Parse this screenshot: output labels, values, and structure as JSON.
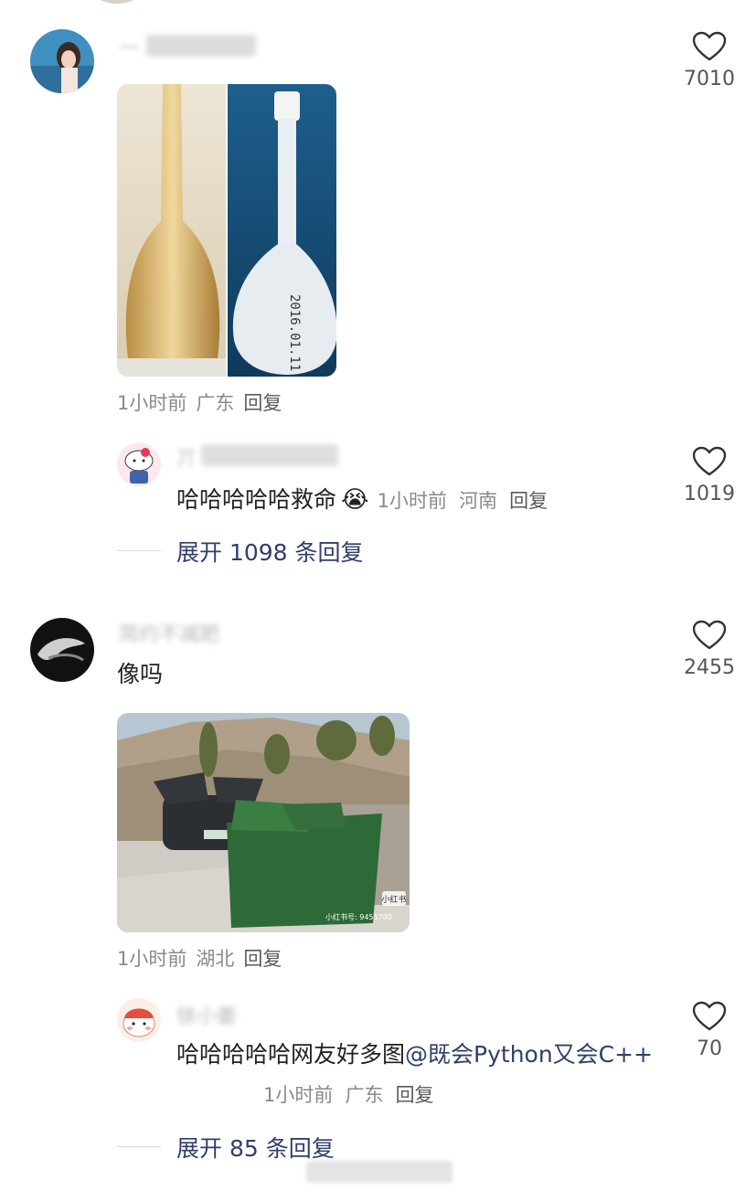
{
  "comments": [
    {
      "name": "一",
      "time": "1小时前",
      "location": "广东",
      "reply": "回复",
      "likes": "7010",
      "reply_preview": {
        "name": "丌",
        "text": "哈哈哈哈哈救命",
        "emoji": "😭",
        "time": "1小时前",
        "location": "河南",
        "reply": "回复",
        "likes": "1019"
      },
      "expand": "展开 1098 条回复"
    },
    {
      "name": "简约不减肥",
      "text": "像吗",
      "time": "1小时前",
      "location": "湖北",
      "reply": "回复",
      "likes": "2455",
      "image_watermark": "小红书",
      "image_watermark_id": "小红书号: 9455780",
      "reply_preview": {
        "name": "徐小姜",
        "text_part1": "哈哈哈哈哈网友好多图",
        "mention": "@既会Python又会C++",
        "time": "1小时前",
        "location": "广东",
        "reply": "回复",
        "likes": "70"
      },
      "expand": "展开 85 条回复"
    }
  ],
  "colors": {
    "link": "#2f3f6b",
    "meta": "#8a8a8a",
    "text": "#222222"
  }
}
